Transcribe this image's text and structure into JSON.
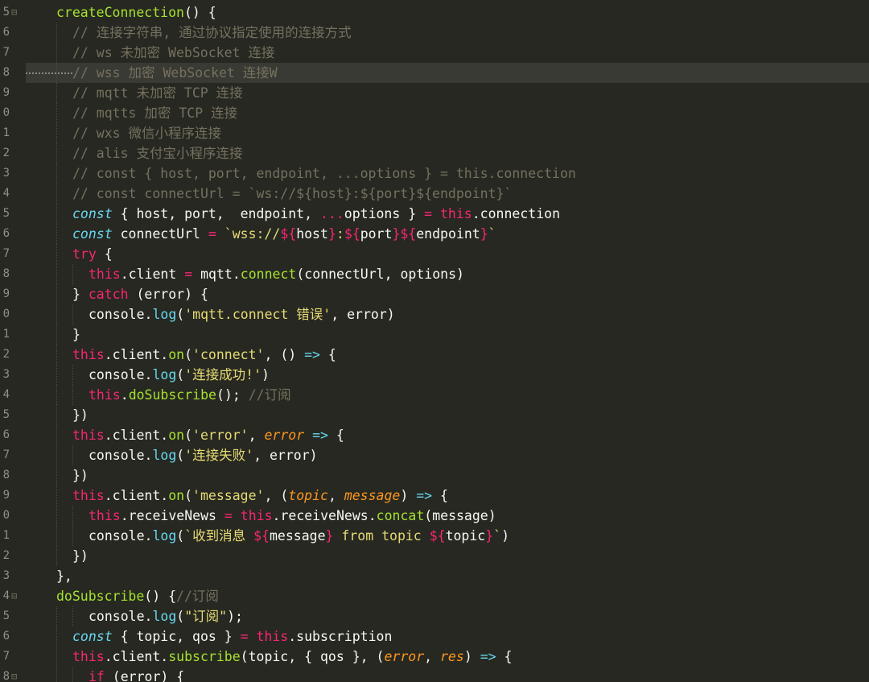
{
  "editor": {
    "theme": "monokai",
    "highlighted_line_index": 3,
    "colors": {
      "background": "#272822",
      "plain": "#f8f8f2",
      "comment": "#75715e",
      "keyword": "#f92672",
      "storage": "#66d9ef",
      "function": "#a6e22e",
      "string": "#e6db74",
      "parameter": "#fd971f"
    },
    "lines": [
      {
        "num": "5",
        "fold": "⊟",
        "indent": 1,
        "tokens": [
          [
            "f",
            "createConnection"
          ],
          [
            "w",
            "() {"
          ]
        ]
      },
      {
        "num": "6",
        "indent": 2,
        "tokens": [
          [
            "c",
            "// 连接字符串, 通过协议指定使用的连接方式"
          ]
        ]
      },
      {
        "num": "7",
        "indent": 2,
        "tokens": [
          [
            "c",
            "// ws 未加密 WebSocket 连接"
          ]
        ]
      },
      {
        "num": "8",
        "indent": 2,
        "tokens": [
          [
            "c",
            "// wss 加密 WebSocket 连接W"
          ]
        ]
      },
      {
        "num": "9",
        "indent": 2,
        "tokens": [
          [
            "c",
            "// mqtt 未加密 TCP 连接"
          ]
        ]
      },
      {
        "num": "0",
        "indent": 2,
        "tokens": [
          [
            "c",
            "// mqtts 加密 TCP 连接"
          ]
        ]
      },
      {
        "num": "1",
        "indent": 2,
        "tokens": [
          [
            "c",
            "// wxs 微信小程序连接"
          ]
        ]
      },
      {
        "num": "2",
        "indent": 2,
        "tokens": [
          [
            "c",
            "// alis 支付宝小程序连接"
          ]
        ]
      },
      {
        "num": "3",
        "indent": 2,
        "tokens": [
          [
            "c",
            "// const { host, port, endpoint, ...options } = this.connection"
          ]
        ]
      },
      {
        "num": "4",
        "indent": 2,
        "tokens": [
          [
            "c",
            "// const connectUrl = `ws://${host}:${port}${endpoint}`"
          ]
        ]
      },
      {
        "num": "5",
        "indent": 2,
        "tokens": [
          [
            "st",
            "const"
          ],
          [
            "w",
            " { host, port,  endpoint, "
          ],
          [
            "k",
            "..."
          ],
          [
            "w",
            "options } "
          ],
          [
            "k",
            "="
          ],
          [
            "w",
            " "
          ],
          [
            "k",
            "this"
          ],
          [
            "w",
            ".connection"
          ]
        ]
      },
      {
        "num": "6",
        "indent": 2,
        "tokens": [
          [
            "st",
            "const"
          ],
          [
            "w",
            " connectUrl "
          ],
          [
            "k",
            "="
          ],
          [
            "w",
            " "
          ],
          [
            "s",
            "`wss://"
          ],
          [
            "k",
            "${"
          ],
          [
            "w",
            "host"
          ],
          [
            "k",
            "}"
          ],
          [
            "s",
            ":"
          ],
          [
            "k",
            "${"
          ],
          [
            "w",
            "port"
          ],
          [
            "k",
            "}${"
          ],
          [
            "w",
            "endpoint"
          ],
          [
            "k",
            "}"
          ],
          [
            "s",
            "`"
          ]
        ]
      },
      {
        "num": "7",
        "indent": 2,
        "tokens": [
          [
            "k",
            "try"
          ],
          [
            "w",
            " {"
          ]
        ]
      },
      {
        "num": "8",
        "indent": 3,
        "tokens": [
          [
            "k",
            "this"
          ],
          [
            "w",
            ".client "
          ],
          [
            "k",
            "="
          ],
          [
            "w",
            " mqtt."
          ],
          [
            "f",
            "connect"
          ],
          [
            "w",
            "(connectUrl, options)"
          ]
        ]
      },
      {
        "num": "9",
        "indent": 2,
        "tokens": [
          [
            "w",
            "} "
          ],
          [
            "k",
            "catch"
          ],
          [
            "w",
            " (error) {"
          ]
        ]
      },
      {
        "num": "0",
        "indent": 3,
        "tokens": [
          [
            "w",
            "console."
          ],
          [
            "fc",
            "log"
          ],
          [
            "w",
            "("
          ],
          [
            "s",
            "'mqtt.connect 错误'"
          ],
          [
            "w",
            ", error)"
          ]
        ]
      },
      {
        "num": "1",
        "indent": 2,
        "tokens": [
          [
            "w",
            "}"
          ]
        ]
      },
      {
        "num": "2",
        "indent": 2,
        "tokens": [
          [
            "k",
            "this"
          ],
          [
            "w",
            ".client."
          ],
          [
            "f",
            "on"
          ],
          [
            "w",
            "("
          ],
          [
            "s",
            "'connect'"
          ],
          [
            "w",
            ", () "
          ],
          [
            "fc",
            "=>"
          ],
          [
            "w",
            " {"
          ]
        ]
      },
      {
        "num": "3",
        "indent": 3,
        "tokens": [
          [
            "w",
            "console."
          ],
          [
            "fc",
            "log"
          ],
          [
            "w",
            "("
          ],
          [
            "s",
            "'连接成功!'"
          ],
          [
            "w",
            ")"
          ]
        ]
      },
      {
        "num": "4",
        "indent": 3,
        "tokens": [
          [
            "k",
            "this"
          ],
          [
            "w",
            "."
          ],
          [
            "f",
            "doSubscribe"
          ],
          [
            "w",
            "(); "
          ],
          [
            "c",
            "//订阅"
          ]
        ]
      },
      {
        "num": "5",
        "indent": 2,
        "tokens": [
          [
            "w",
            "})"
          ]
        ]
      },
      {
        "num": "6",
        "indent": 2,
        "tokens": [
          [
            "k",
            "this"
          ],
          [
            "w",
            ".client."
          ],
          [
            "f",
            "on"
          ],
          [
            "w",
            "("
          ],
          [
            "s",
            "'error'"
          ],
          [
            "w",
            ", "
          ],
          [
            "p",
            "error"
          ],
          [
            "w",
            " "
          ],
          [
            "fc",
            "=>"
          ],
          [
            "w",
            " {"
          ]
        ]
      },
      {
        "num": "7",
        "indent": 3,
        "tokens": [
          [
            "w",
            "console."
          ],
          [
            "fc",
            "log"
          ],
          [
            "w",
            "("
          ],
          [
            "s",
            "'连接失败'"
          ],
          [
            "w",
            ", error)"
          ]
        ]
      },
      {
        "num": "8",
        "indent": 2,
        "tokens": [
          [
            "w",
            "})"
          ]
        ]
      },
      {
        "num": "9",
        "indent": 2,
        "tokens": [
          [
            "k",
            "this"
          ],
          [
            "w",
            ".client."
          ],
          [
            "f",
            "on"
          ],
          [
            "w",
            "("
          ],
          [
            "s",
            "'message'"
          ],
          [
            "w",
            ", ("
          ],
          [
            "p",
            "topic"
          ],
          [
            "w",
            ", "
          ],
          [
            "p",
            "message"
          ],
          [
            "w",
            ") "
          ],
          [
            "fc",
            "=>"
          ],
          [
            "w",
            " {"
          ]
        ]
      },
      {
        "num": "0",
        "indent": 3,
        "tokens": [
          [
            "k",
            "this"
          ],
          [
            "w",
            ".receiveNews "
          ],
          [
            "k",
            "="
          ],
          [
            "w",
            " "
          ],
          [
            "k",
            "this"
          ],
          [
            "w",
            ".receiveNews."
          ],
          [
            "f",
            "concat"
          ],
          [
            "w",
            "(message)"
          ]
        ]
      },
      {
        "num": "1",
        "indent": 3,
        "tokens": [
          [
            "w",
            "console."
          ],
          [
            "fc",
            "log"
          ],
          [
            "w",
            "("
          ],
          [
            "s",
            "`收到消息 "
          ],
          [
            "k",
            "${"
          ],
          [
            "w",
            "message"
          ],
          [
            "k",
            "}"
          ],
          [
            "s",
            " from topic "
          ],
          [
            "k",
            "${"
          ],
          [
            "w",
            "topic"
          ],
          [
            "k",
            "}"
          ],
          [
            "s",
            "`"
          ],
          [
            "w",
            ")"
          ]
        ]
      },
      {
        "num": "2",
        "indent": 2,
        "tokens": [
          [
            "w",
            "})"
          ]
        ]
      },
      {
        "num": "3",
        "indent": 1,
        "tokens": [
          [
            "w",
            "},"
          ]
        ]
      },
      {
        "num": "4",
        "fold": "⊟",
        "indent": 1,
        "tokens": [
          [
            "f",
            "doSubscribe"
          ],
          [
            "w",
            "() {"
          ],
          [
            "c",
            "//订阅"
          ]
        ]
      },
      {
        "num": "5",
        "indent": 3,
        "tokens": [
          [
            "w",
            "console."
          ],
          [
            "fc",
            "log"
          ],
          [
            "w",
            "("
          ],
          [
            "s",
            "\"订阅\""
          ],
          [
            "w",
            ");"
          ]
        ]
      },
      {
        "num": "6",
        "indent": 2,
        "tokens": [
          [
            "st",
            "const"
          ],
          [
            "w",
            " { topic, qos } "
          ],
          [
            "k",
            "="
          ],
          [
            "w",
            " "
          ],
          [
            "k",
            "this"
          ],
          [
            "w",
            ".subscription"
          ]
        ]
      },
      {
        "num": "7",
        "indent": 2,
        "tokens": [
          [
            "k",
            "this"
          ],
          [
            "w",
            ".client."
          ],
          [
            "f",
            "subscribe"
          ],
          [
            "w",
            "(topic, { qos }, ("
          ],
          [
            "p",
            "error"
          ],
          [
            "w",
            ", "
          ],
          [
            "p",
            "res"
          ],
          [
            "w",
            ") "
          ],
          [
            "fc",
            "=>"
          ],
          [
            "w",
            " {"
          ]
        ]
      },
      {
        "num": "8",
        "fold": "⊟",
        "indent": 3,
        "tokens": [
          [
            "k",
            "if"
          ],
          [
            "w",
            " (error) {"
          ]
        ]
      }
    ]
  }
}
